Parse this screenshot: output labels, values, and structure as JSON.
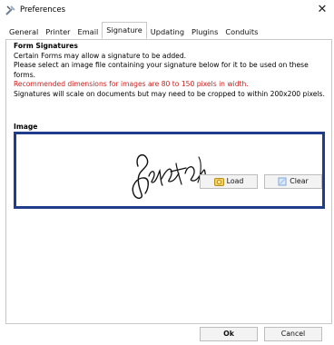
{
  "window": {
    "title": "Preferences"
  },
  "tabs": [
    {
      "label": "General"
    },
    {
      "label": "Printer"
    },
    {
      "label": "Email"
    },
    {
      "label": "Signature"
    },
    {
      "label": "Updating"
    },
    {
      "label": "Plugins"
    },
    {
      "label": "Conduits"
    }
  ],
  "signature": {
    "section_title": "Form Signatures",
    "line1": "Certain Forms may allow a signature to be added.",
    "line2": "Please select an image file containing your signature below for it to be used on these",
    "line3": "forms.",
    "warning": "Recommended dimensions for images are 80 to 150 pixels in width.",
    "line4": "Signatures will scale on documents but may need to be cropped to within 200x200 pixels.",
    "image_label": "Image",
    "load_label": "Load",
    "clear_label": "Clear"
  },
  "footer": {
    "ok_label": "Ok",
    "cancel_label": "Cancel"
  },
  "colors": {
    "warning": "#cc1f1f",
    "image_border": "#1f3d8a"
  },
  "icons": {
    "app": "preferences-icon",
    "close": "close-icon",
    "load": "load-icon",
    "clear": "clear-icon"
  }
}
